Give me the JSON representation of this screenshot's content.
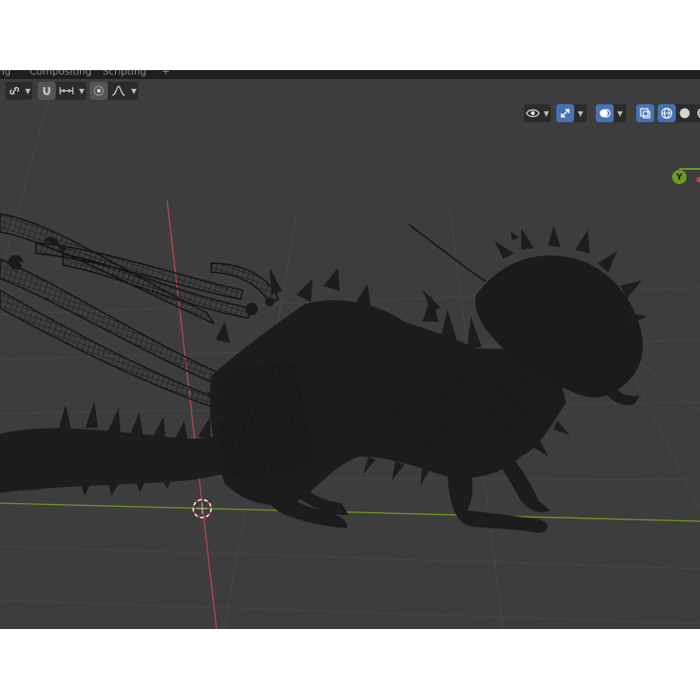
{
  "workspace_tabs": [
    {
      "label": "ng"
    },
    {
      "label": "Compositing"
    },
    {
      "label": "Scripting"
    },
    {
      "label": "+"
    }
  ],
  "header_left": {
    "transform_pivot_icon": "link-icon",
    "snap_icon": "magnet-icon",
    "snap_target_icon": "snap-increment-icon",
    "proportional_icon": "proportional-edit-icon",
    "falloff_icon": "falloff-curve-icon"
  },
  "header_right": {
    "visibility_icon": "eye-icon",
    "gizmo_icon": "gizmo-icon",
    "overlay_icon": "overlay-icon",
    "xray_icon": "xray-icon",
    "shading_modes": [
      "wireframe",
      "solid",
      "material",
      "rendered"
    ]
  },
  "navigation_gizmo": {
    "y_label": "Y",
    "y_color": "#6e9a22"
  },
  "colors": {
    "viewport_bg": "#3d3d3d",
    "grid_line": "#464646",
    "x_axis": "#b8484f",
    "y_axis": "#6e9a22",
    "model": "#1c1c1c",
    "wire": "#101010",
    "accent": "#4772b3"
  }
}
